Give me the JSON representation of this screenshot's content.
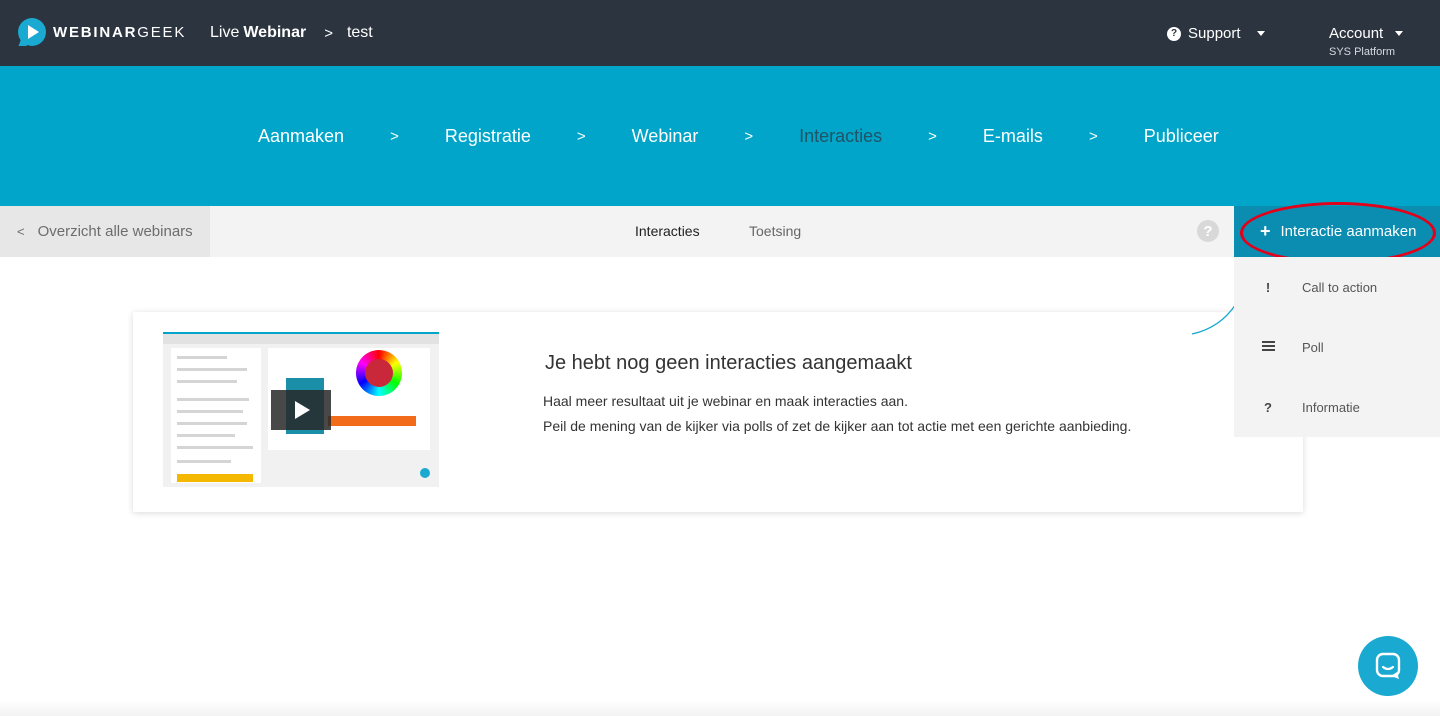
{
  "topbar": {
    "logo_bold": "WEBINAR",
    "logo_light": "GEEK",
    "crumb_prefix": "Live",
    "crumb_bold": "Webinar",
    "crumb_sep": ">",
    "crumb_current": "test",
    "support_label": "Support",
    "account_label": "Account",
    "account_sub": "SYS Platform"
  },
  "steps": [
    {
      "label": "Aanmaken",
      "active": false
    },
    {
      "label": "Registratie",
      "active": false
    },
    {
      "label": "Webinar",
      "active": false
    },
    {
      "label": "Interacties",
      "active": true
    },
    {
      "label": "E-mails",
      "active": false
    },
    {
      "label": "Publiceer",
      "active": false
    }
  ],
  "step_sep": ">",
  "subbar": {
    "back_chevron": "<",
    "back_label": "Overzicht alle webinars",
    "tab_interacties": "Interacties",
    "tab_toetsing": "Toetsing",
    "help_glyph": "?",
    "create_plus": "+",
    "create_label": "Interactie aanmaken"
  },
  "menu": {
    "items": [
      {
        "icon": "exclamation-icon",
        "glyph": "!",
        "label": "Call to action"
      },
      {
        "icon": "list-icon",
        "glyph": "",
        "label": "Poll"
      },
      {
        "icon": "question-icon",
        "glyph": "?",
        "label": "Informatie"
      }
    ]
  },
  "empty": {
    "title": "Je hebt nog geen interacties aangemaakt",
    "line1": "Haal meer resultaat uit je webinar en maak interacties aan.",
    "line2": "Peil de mening van de kijker via polls of zet de kijker aan tot actie met een gerichte aanbieding."
  },
  "colors": {
    "topbar": "#2c3440",
    "accent": "#00a5c9",
    "button": "#0a8db0",
    "highlight_ring": "#e2001a"
  }
}
